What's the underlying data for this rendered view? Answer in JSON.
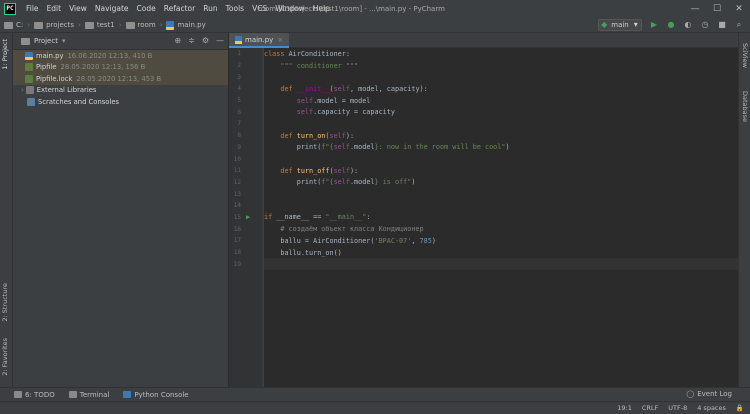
{
  "app": {
    "logo_text": "PC",
    "window_title": "room [C:\\projects\\test1\\room] - ...\\main.py - PyCharm"
  },
  "menu": [
    "File",
    "Edit",
    "View",
    "Navigate",
    "Code",
    "Refactor",
    "Run",
    "Tools",
    "VCS",
    "Window",
    "Help"
  ],
  "window_controls": {
    "minimize": "—",
    "maximize": "☐",
    "close": "✕"
  },
  "breadcrumb": [
    "C:",
    "projects",
    "test1",
    "room",
    "main.py"
  ],
  "toolbar": {
    "run_config": "main"
  },
  "left_tabs": {
    "project": "1: Project",
    "structure": "2: Structure",
    "favorites": "2: Favorites"
  },
  "right_tabs": {
    "scview": "SciView",
    "database": "Database"
  },
  "project_panel": {
    "title": "Project",
    "files": [
      {
        "name": "main.py",
        "meta": "16.06.2020 12:13, 410 B",
        "type": "py"
      },
      {
        "name": "Pipfile",
        "meta": "28.05.2020 12:13, 156 B",
        "type": "pipfile"
      },
      {
        "name": "Pipfile.lock",
        "meta": "28.05.2020 12:13, 453 B",
        "type": "pipfile"
      },
      {
        "name": "External Libraries",
        "meta": "",
        "type": "lib"
      },
      {
        "name": "Scratches and Consoles",
        "meta": "",
        "type": "scratch"
      }
    ]
  },
  "editor": {
    "tab_label": "main.py",
    "lines": [
      "class AirConditioner:",
      "    \"\"\" conditioner \"\"\"",
      "",
      "    def __init__(self, model, capacity):",
      "        self.model = model",
      "        self.capacity = capacity",
      "",
      "    def turn_on(self):",
      "        print(f\"{self.model}: now in the room will be cool\")",
      "",
      "    def turn_off(self):",
      "        print(f\"{self.model} is off\")",
      "",
      "",
      "if __name__ == \"__main__\":",
      "    # создаём объект класса Кондиционер",
      "    ballu = AirConditioner('BPAC-07', 785)",
      "    ballu.turn_on()",
      ""
    ]
  },
  "bottom_tools": [
    "6: TODO",
    "Terminal",
    "Python Console"
  ],
  "event_log": "Event Log",
  "status": {
    "position": "19:1",
    "line_sep": "CRLF",
    "encoding": "UTF-8",
    "indent": "4 spaces"
  }
}
